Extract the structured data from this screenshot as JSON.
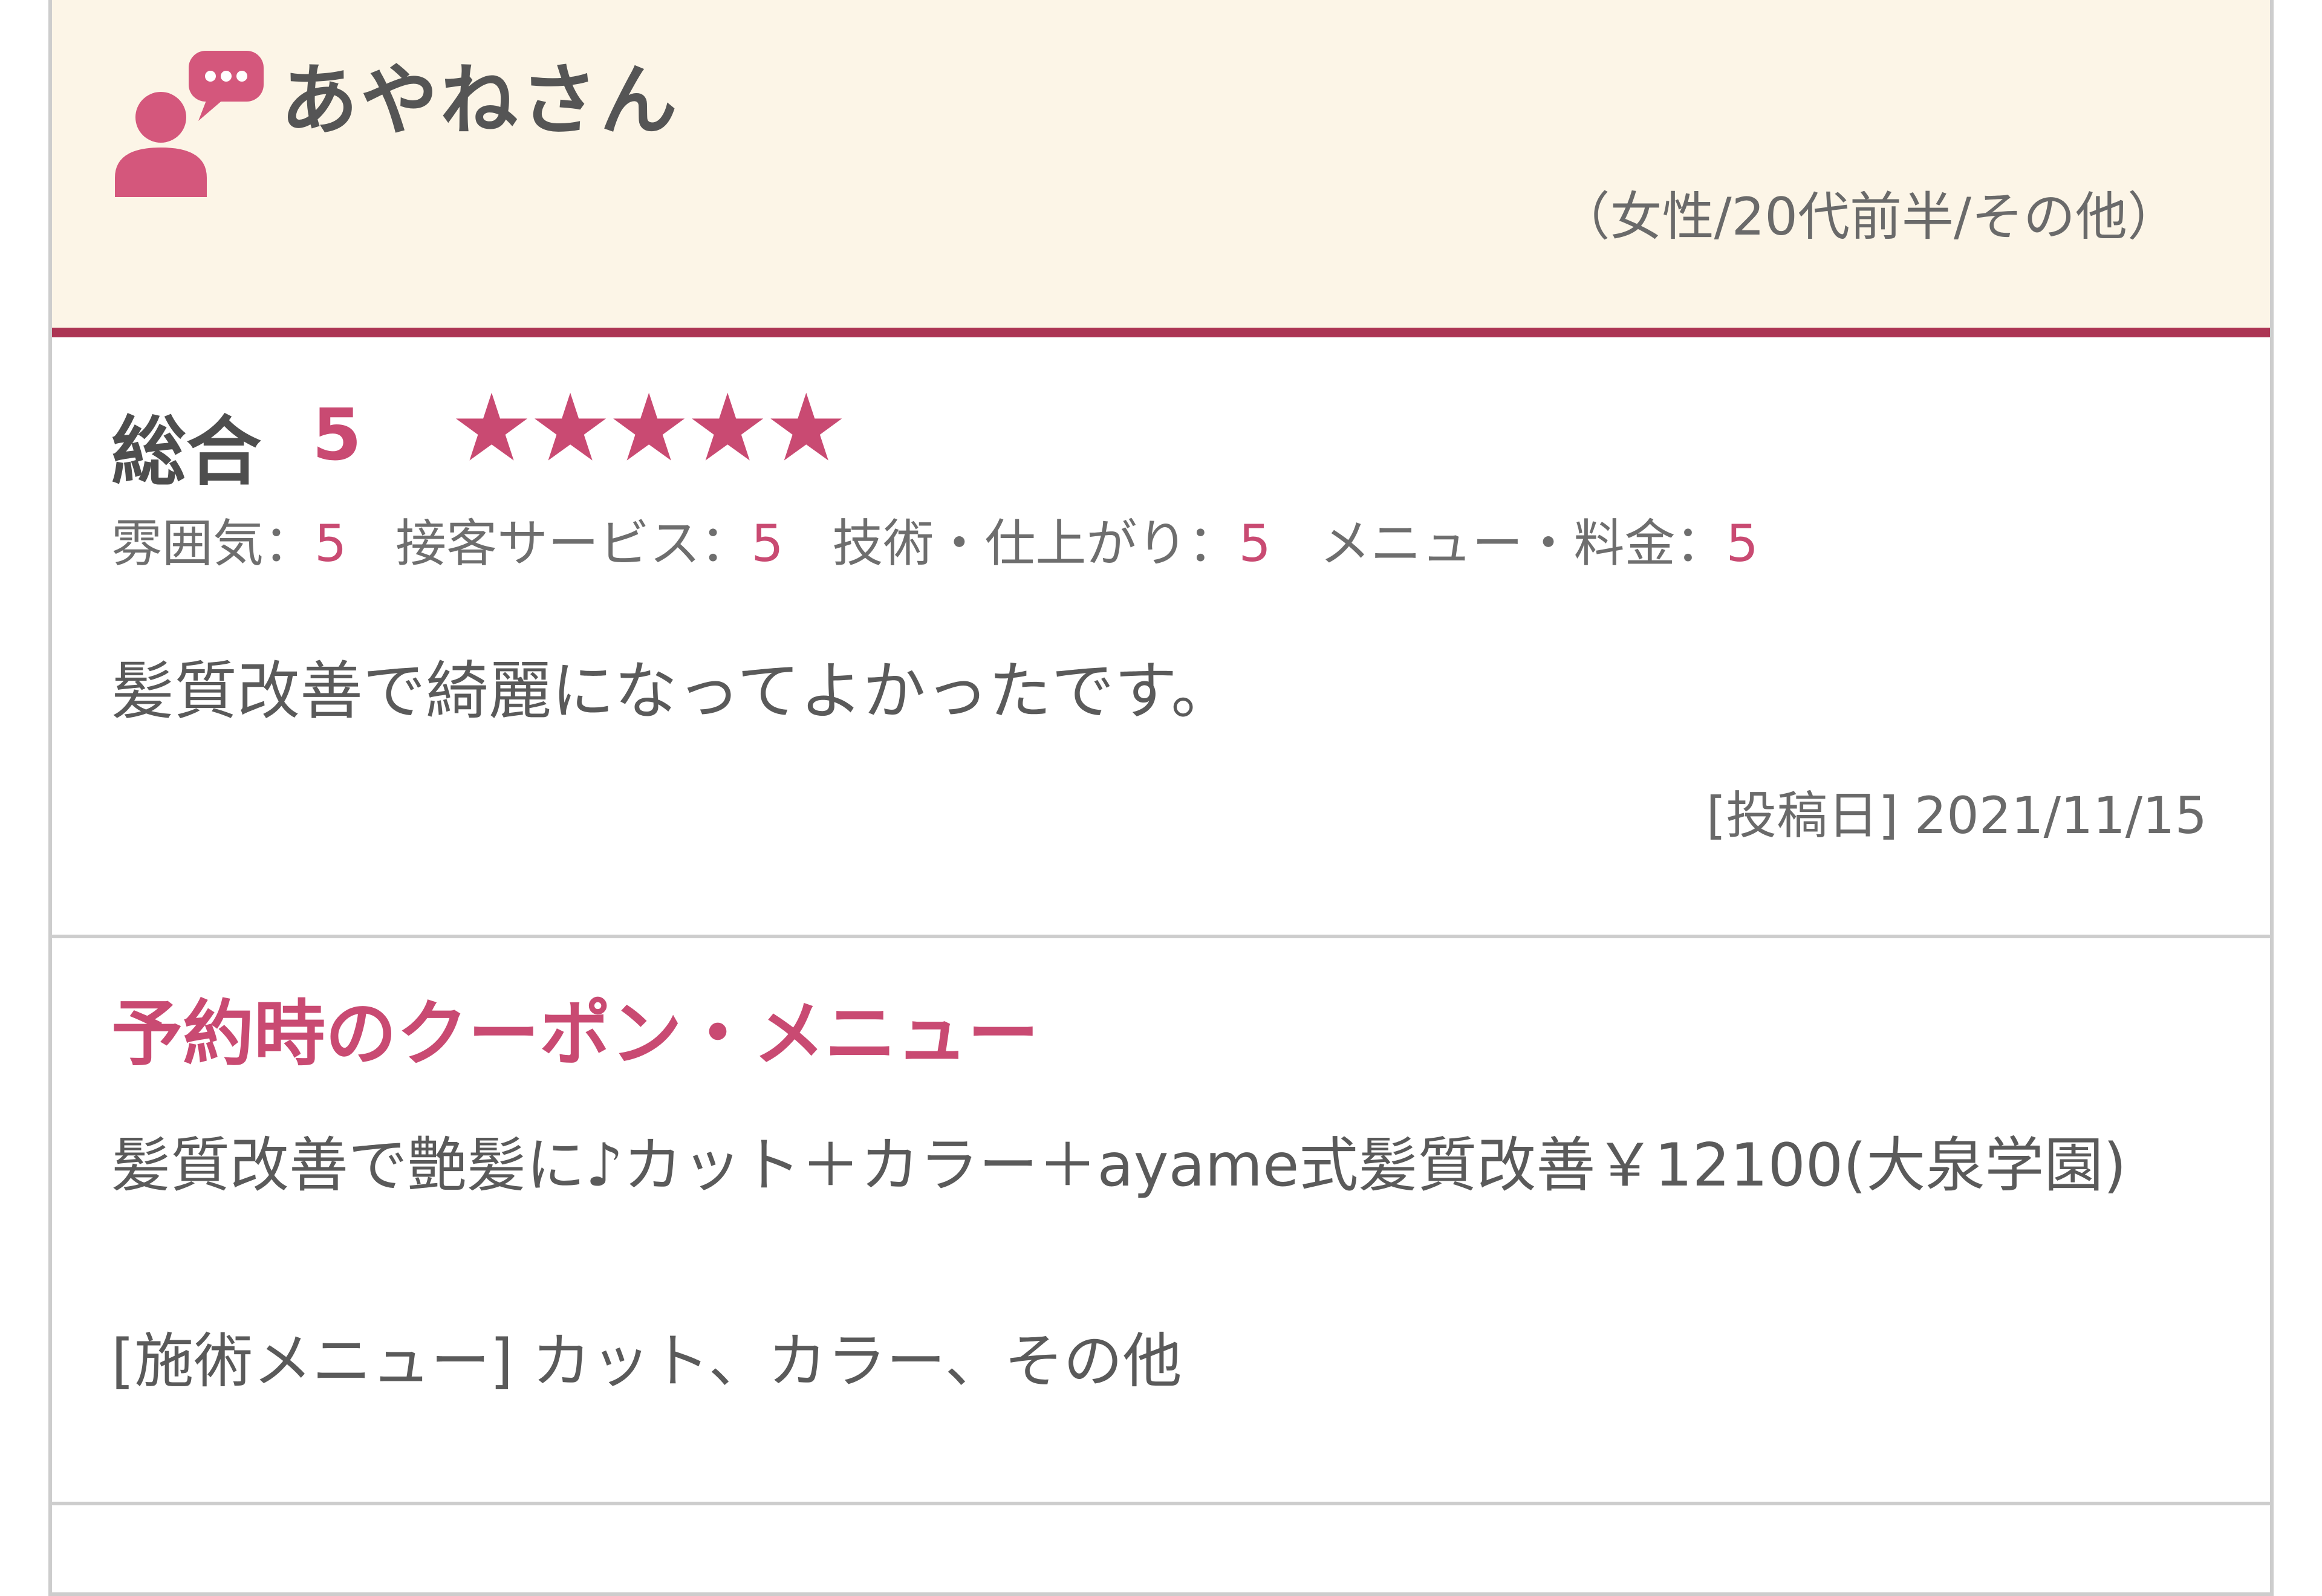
{
  "reviewer": {
    "name": "あやねさん",
    "meta": "（女性/20代前半/その他）",
    "icon": "reviewer-speech-icon"
  },
  "rating": {
    "label": "総合",
    "score": "5",
    "stars": "★★★★★",
    "star_count": 5,
    "star_max": 5
  },
  "sub_ratings": [
    {
      "label": "雰囲気：",
      "value": "5"
    },
    {
      "label": "接客サービス：",
      "value": "5"
    },
    {
      "label": "技術・仕上がり：",
      "value": "5"
    },
    {
      "label": "メニュー・料金：",
      "value": "5"
    }
  ],
  "comment": "髪質改善で綺麗になってよかったです。",
  "post_date": "[投稿日] 2021/11/15",
  "coupon": {
    "title": "予約時のクーポン・メニュー",
    "text": "髪質改善で艶髪に♪カット＋カラー＋ayame式髪質改善￥12100(大泉学園)",
    "menu": "[施術メニュー] カット、カラー、その他"
  },
  "colors": {
    "accent": "#c94a72",
    "header_bg": "#fcf5e7",
    "header_border": "#ac3554",
    "text": "#5a5a5a",
    "border": "#cdcdcd"
  }
}
